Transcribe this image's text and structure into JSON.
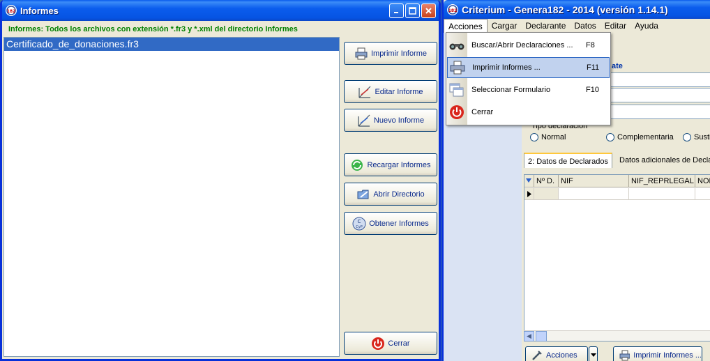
{
  "informes_window": {
    "title": "Informes",
    "header": "Informes: Todos los archivos con extensión *.fr3 y *.xml del directorio Informes",
    "files": [
      "Certificado_de_donaciones.fr3"
    ],
    "buttons": {
      "imprimir": "Imprimir Informe",
      "editar": "Editar Informe",
      "nuevo": "Nuevo Informe",
      "recargar": "Recargar Informes",
      "abrir": "Abrir Directorio",
      "obtener": "Obtener Informes",
      "cerrar": "Cerrar"
    }
  },
  "criterium_window": {
    "title": "Criterium - Genera182 - 2014 (versión 1.14.1)",
    "menu": [
      "Acciones",
      "Cargar",
      "Declarante",
      "Datos",
      "Editar",
      "Ayuda"
    ],
    "dropdown": [
      {
        "label": "Buscar/Abrir Declaraciones ...",
        "key": "F8",
        "icon": "binoculars-icon"
      },
      {
        "label": "Imprimir Informes ...",
        "key": "F11",
        "icon": "printer-icon"
      },
      {
        "label": "Seleccionar Formulario",
        "key": "F10",
        "icon": "windows-icon"
      },
      {
        "label": "Cerrar",
        "key": "",
        "icon": "power-icon"
      }
    ],
    "section_label": "ate",
    "tipo_label": "Tipo declaración",
    "radios": [
      "Normal",
      "Complementaria",
      "Sustit"
    ],
    "tabs": [
      "2: Datos de Declarados",
      "Datos adicionales de Declar"
    ],
    "grid_columns": [
      "Nº D.",
      "NIF",
      "NIF_REPRLEGAL",
      "NOM"
    ],
    "bottom_buttons": {
      "acciones": "Acciones",
      "imprimir": "Imprimir Informes ..."
    }
  }
}
